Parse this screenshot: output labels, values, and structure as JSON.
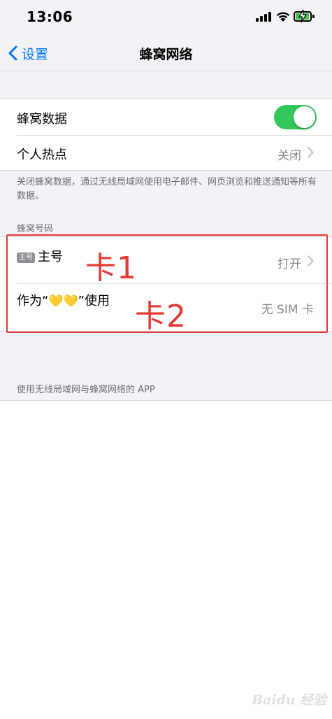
{
  "status": {
    "time": "13:06"
  },
  "nav": {
    "back_label": "设置",
    "title": "蜂窝网络"
  },
  "cellular": {
    "data_label": "蜂窝数据",
    "data_on": true,
    "hotspot_label": "个人热点",
    "hotspot_value": "关闭",
    "footnote": "关闭蜂窝数据，通过无线局域网使用电子邮件、网页浏览和推送通知等所有数据。"
  },
  "numbers": {
    "header": "蜂窝号码",
    "primary_badge": "主号",
    "primary_label": "主号",
    "primary_value": "打开",
    "secondary_prefix": "作为“",
    "secondary_emoji": "💛💛",
    "secondary_suffix": "”使用",
    "secondary_value": "无 SIM 卡"
  },
  "annotations": {
    "card1": "卡1",
    "card2": "卡2"
  },
  "apps": {
    "header": "使用无线局域网与蜂窝网络的 APP"
  },
  "watermark": {
    "text": "Baidu 经验"
  },
  "colors": {
    "accent": "#007aff",
    "toggle_on": "#34c759",
    "annotation": "#e53935"
  }
}
